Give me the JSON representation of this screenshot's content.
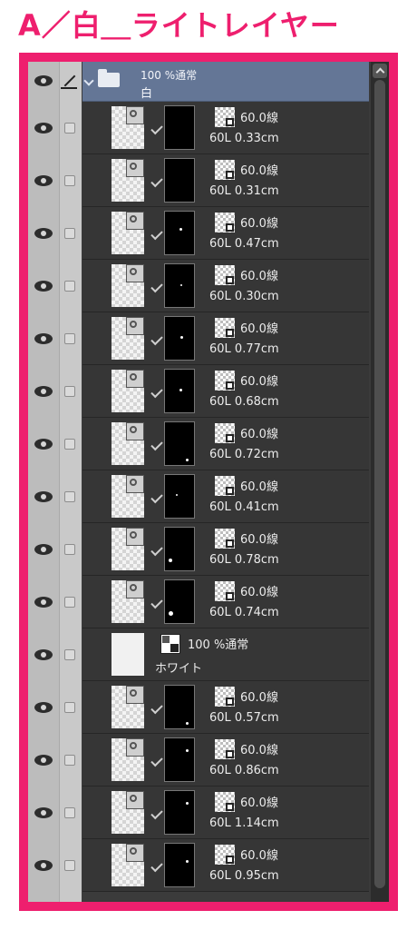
{
  "title": "A／白＿ライトレイヤー",
  "folder": {
    "mode": "100 %通常",
    "name": "白",
    "icons": [
      "chevron-down-icon",
      "folder-icon",
      "pen-icon",
      "eye-icon"
    ]
  },
  "layers": [
    {
      "blend": "60.0線",
      "meta": "60L 0.33cm"
    },
    {
      "blend": "60.0線",
      "meta": "60L 0.31cm"
    },
    {
      "blend": "60.0線",
      "meta": "60L 0.47cm"
    },
    {
      "blend": "60.0線",
      "meta": "60L 0.30cm"
    },
    {
      "blend": "60.0線",
      "meta": "60L 0.77cm"
    },
    {
      "blend": "60.0線",
      "meta": "60L 0.68cm"
    },
    {
      "blend": "60.0線",
      "meta": "60L 0.72cm"
    },
    {
      "blend": "60.0線",
      "meta": "60L 0.41cm"
    },
    {
      "blend": "60.0線",
      "meta": "60L 0.78cm"
    },
    {
      "blend": "60.0線",
      "meta": "60L 0.74cm"
    }
  ],
  "paper_layer": {
    "mode": "100 %通常",
    "name": "ホワイト"
  },
  "layers_after": [
    {
      "blend": "60.0線",
      "meta": "60L 0.57cm"
    },
    {
      "blend": "60.0線",
      "meta": "60L 0.86cm"
    },
    {
      "blend": "60.0線",
      "meta": "60L 1.14cm"
    },
    {
      "blend": "60.0線",
      "meta": "60L 0.95cm"
    }
  ],
  "colors": {
    "accent": "#ee1f6e",
    "panel": "#363636",
    "folder_row": "#647696"
  }
}
